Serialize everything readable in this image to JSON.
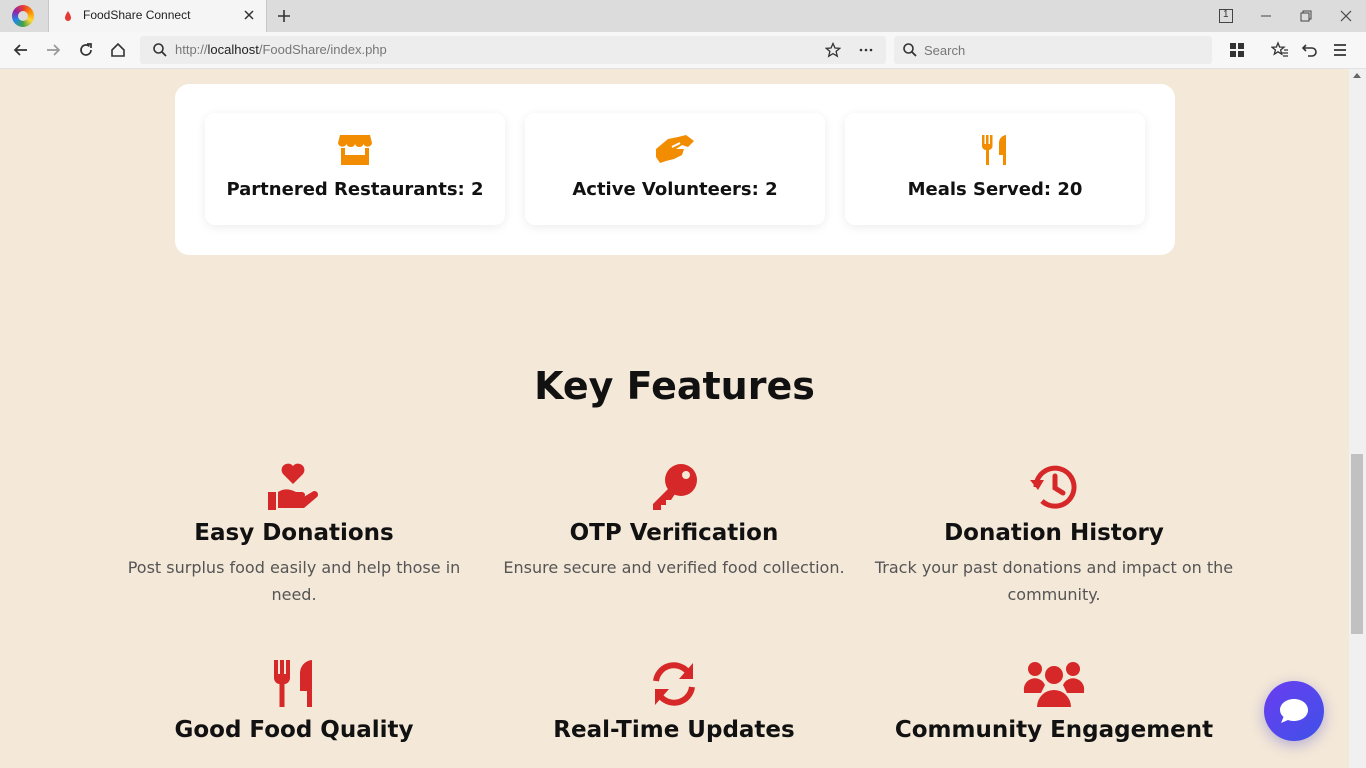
{
  "browser": {
    "tab_title": "FoodShare Connect",
    "url_prefix": "http://",
    "url_host": "localhost",
    "url_path": "/FoodShare/index.php",
    "search_placeholder": "Search",
    "tab_counter": "1"
  },
  "stats": [
    {
      "label": "Partnered Restaurants: 2",
      "icon": "store-icon"
    },
    {
      "label": "Active Volunteers: 2",
      "icon": "handshake-icon"
    },
    {
      "label": "Meals Served: 20",
      "icon": "utensils-icon"
    }
  ],
  "features": {
    "title": "Key Features",
    "items": [
      {
        "title": "Easy Donations",
        "desc": "Post surplus food easily and help those in need.",
        "icon": "heart-hand-icon"
      },
      {
        "title": "OTP Verification",
        "desc": "Ensure secure and verified food collection.",
        "icon": "key-icon"
      },
      {
        "title": "Donation History",
        "desc": "Track your past donations and impact on the community.",
        "icon": "history-icon"
      },
      {
        "title": "Good Food Quality",
        "desc": "",
        "icon": "utensils-icon"
      },
      {
        "title": "Real-Time Updates",
        "desc": "",
        "icon": "sync-icon"
      },
      {
        "title": "Community Engagement",
        "desc": "",
        "icon": "users-icon"
      }
    ]
  },
  "colors": {
    "page_bg": "#f4e8d8",
    "stat_icon": "#f28c00",
    "feature_icon": "#d62828",
    "chat_button": "#5b3ef0"
  }
}
